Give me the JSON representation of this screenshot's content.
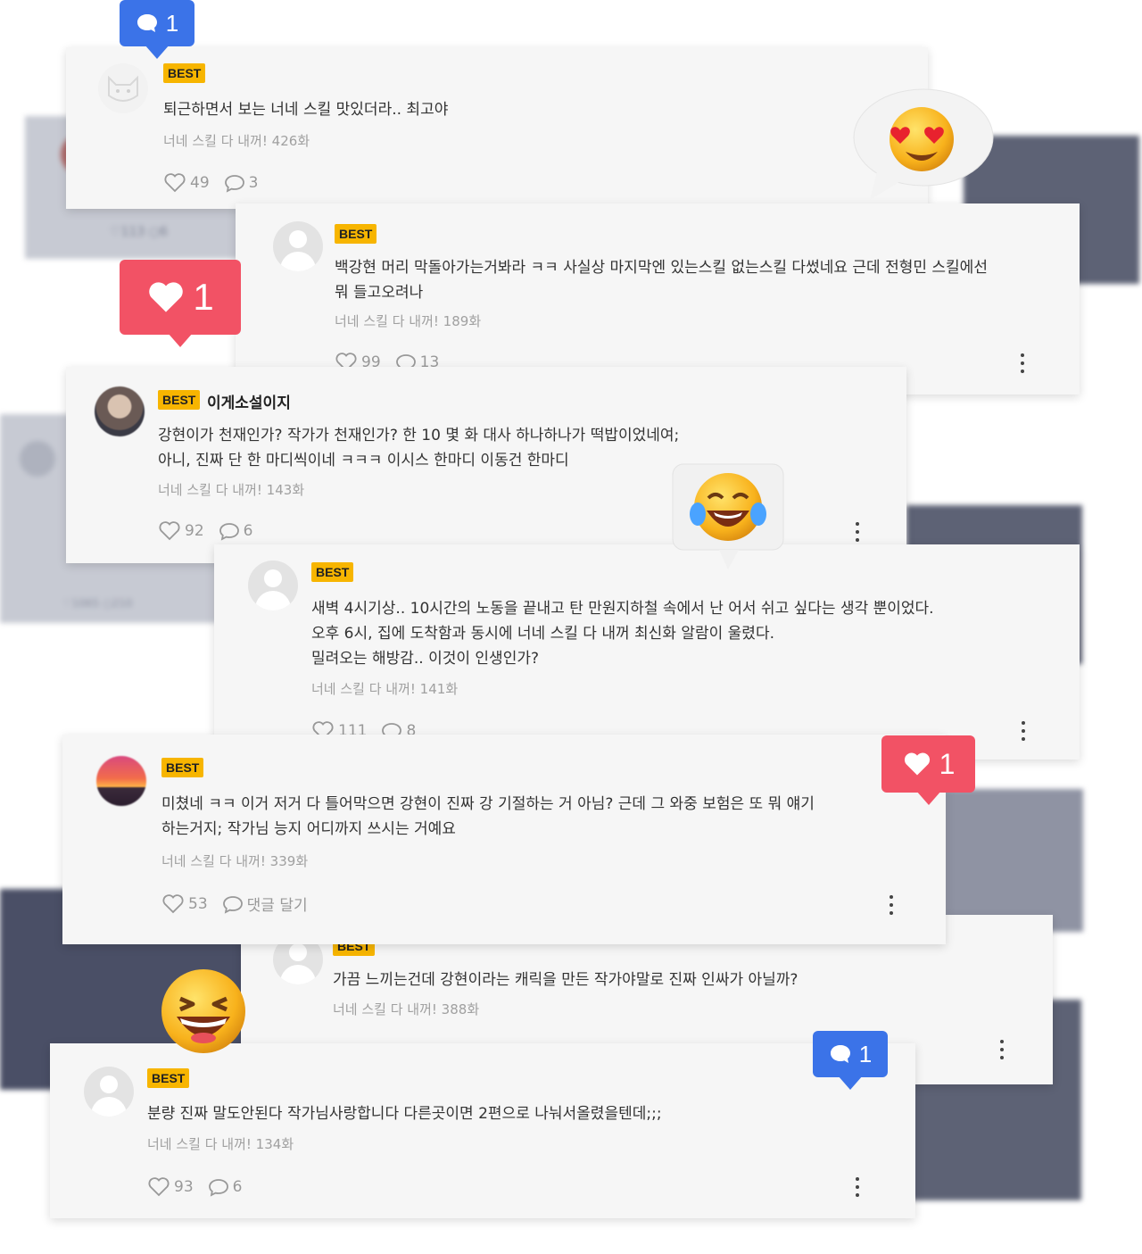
{
  "comments": [
    {
      "best": "BEST",
      "nick": "",
      "text": [
        "퇴근하면서 보는 너네 스킬 맛있더라.. 최고야"
      ],
      "episode": "너네 스킬 다 내꺼! 426화",
      "likes": "49",
      "replies": "3"
    },
    {
      "best": "BEST",
      "nick": "",
      "text": [
        "백강현 머리 막돌아가는거봐라 ㅋㅋ 사실상 마지막엔 있는스킬 없는스킬 다썼네요 근데 전형민 스킬에선",
        "뭐 들고오려나"
      ],
      "episode": "너네 스킬 다 내꺼! 189화",
      "likes": "99",
      "replies": "13"
    },
    {
      "best": "BEST",
      "nick": "이게소설이지",
      "text": [
        "강현이가 천재인가? 작가가 천재인가? 한 10 몇 화 대사 하나하나가 떡밥이었네여;",
        "아니, 진짜 단 한 마디씩이네 ㅋㅋㅋ 이시스 한마디 이동건 한마디"
      ],
      "episode": "너네 스킬 다 내꺼! 143화",
      "likes": "92",
      "replies": "6"
    },
    {
      "best": "BEST",
      "nick": "",
      "text": [
        "새벽 4시기상.. 10시간의 노동을 끝내고 탄 만원지하철 속에서 난 어서 쉬고 싶다는 생각 뿐이었다.",
        "오후 6시, 집에 도착함과 동시에 너네 스킬 다 내꺼 최신화 알람이 울렸다.",
        "밀려오는 해방감.. 이것이 인생인가?"
      ],
      "episode": "너네 스킬 다 내꺼! 141화",
      "likes": "111",
      "replies": "8"
    },
    {
      "best": "BEST",
      "nick": "",
      "text": [
        "미쳤네 ㅋㅋ 이거 저거 다 틀어막으면 강현이 진짜 강 기절하는 거 아님? 근데 그 와중 보험은 또 뭐 얘기",
        "하는거지; 작가님 능지 어디까지 쓰시는 거예요"
      ],
      "episode": "너네 스킬 다 내꺼! 339화",
      "likes": "53",
      "replies": "댓글 달기"
    },
    {
      "best": "BEST",
      "nick": "",
      "text": [
        "가끔 느끼는건데 강현이라는 캐릭을 만든 작가야말로 진짜 인싸가 아닐까?"
      ],
      "episode": "너네 스킬 다 내꺼! 388화",
      "likes": "",
      "replies": ""
    },
    {
      "best": "BEST",
      "nick": "",
      "text": [
        "분량 진짜 말도안된다 작가님사랑합니다 다른곳이면 2편으로 나눠서올렸을텐데;;;"
      ],
      "episode": "너네 스킬 다 내꺼! 134화",
      "likes": "93",
      "replies": "6"
    }
  ],
  "badges": [
    {
      "type": "comment",
      "count": "1",
      "color": "#3b73e8"
    },
    {
      "type": "like",
      "count": "1",
      "color": "#f25265"
    },
    {
      "type": "like",
      "count": "1",
      "color": "#f25265"
    },
    {
      "type": "comment",
      "count": "1",
      "color": "#3b73e8"
    }
  ],
  "background_meta": {
    "likes": "113",
    "replies": "6",
    "likes2": "1065",
    "replies2": "210"
  },
  "emojis": [
    "heart-eyes",
    "tears-of-joy",
    "grinning-squint"
  ]
}
